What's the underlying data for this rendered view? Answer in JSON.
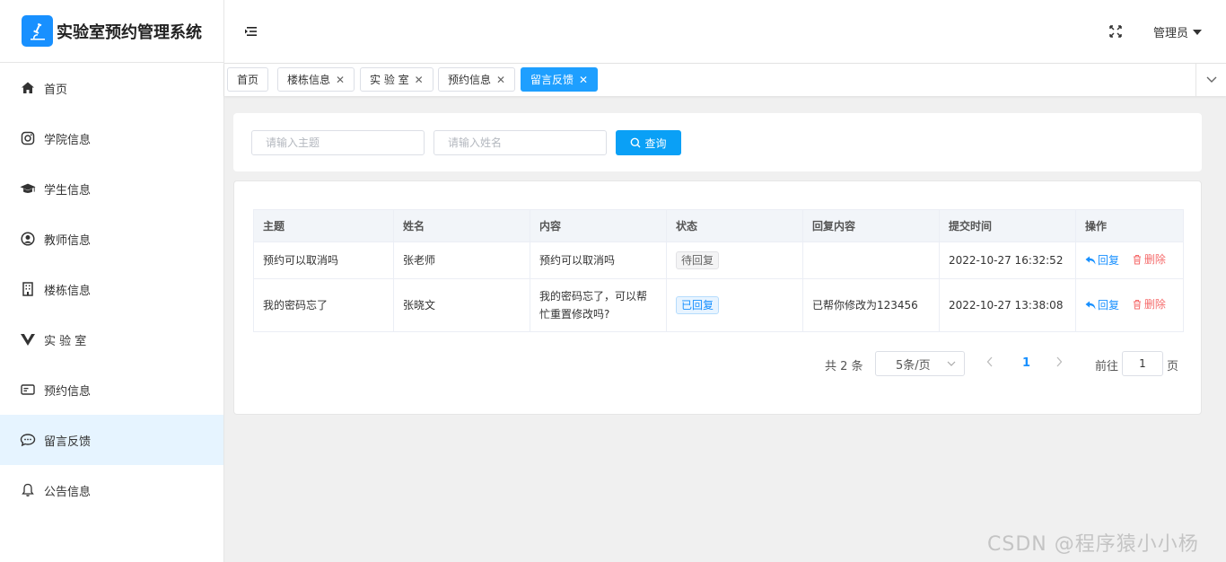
{
  "app": {
    "title": "实验室预约管理系统"
  },
  "sidebar": {
    "items": [
      {
        "label": "首页",
        "icon": "home-icon",
        "active": false
      },
      {
        "label": "学院信息",
        "icon": "instagram-icon",
        "active": false
      },
      {
        "label": "学生信息",
        "icon": "graduation-cap-icon",
        "active": false
      },
      {
        "label": "教师信息",
        "icon": "user-circle-icon",
        "active": false
      },
      {
        "label": "楼栋信息",
        "icon": "building-icon",
        "active": false
      },
      {
        "label": "实 验 室",
        "icon": "lab-logo-icon",
        "active": false
      },
      {
        "label": "预约信息",
        "icon": "id-card-icon",
        "active": false
      },
      {
        "label": "留言反馈",
        "icon": "chat-bubble-icon",
        "active": true
      },
      {
        "label": "公告信息",
        "icon": "bell-icon",
        "active": false
      }
    ]
  },
  "header": {
    "user": "管理员"
  },
  "tabs": [
    {
      "label": "首页",
      "closable": false,
      "active": false
    },
    {
      "label": "楼栋信息",
      "closable": true,
      "active": false
    },
    {
      "label": "实 验 室",
      "closable": true,
      "active": false
    },
    {
      "label": "预约信息",
      "closable": true,
      "active": false
    },
    {
      "label": "留言反馈",
      "closable": true,
      "active": true
    }
  ],
  "search": {
    "subject_placeholder": "请输入主题",
    "name_placeholder": "请输入姓名",
    "query_label": "查询"
  },
  "table": {
    "columns": [
      "主题",
      "姓名",
      "内容",
      "状态",
      "回复内容",
      "提交时间",
      "操作"
    ],
    "rows": [
      {
        "subject": "预约可以取消吗",
        "name": "张老师",
        "content": "预约可以取消吗",
        "status": "待回复",
        "reply": "",
        "time": "2022-10-27 16:32:52"
      },
      {
        "subject": "我的密码忘了",
        "name": "张晓文",
        "content": "我的密码忘了，可以帮忙重置修改吗?",
        "status": "已回复",
        "reply": "已帮你修改为123456",
        "time": "2022-10-27 13:38:08"
      }
    ],
    "actions": {
      "reply": "回复",
      "delete": "删除"
    }
  },
  "pagination": {
    "total": "共 2 条",
    "page_size": "5条/页",
    "current": "1",
    "goto": "前往",
    "goto_value": "1",
    "page_suffix": "页"
  },
  "watermark": "CSDN @程序猿小小杨",
  "colors": {
    "primary": "#0aa0f6",
    "link": "#1890ff",
    "danger": "#f56c6c",
    "active_bg": "#e6f4ff"
  }
}
